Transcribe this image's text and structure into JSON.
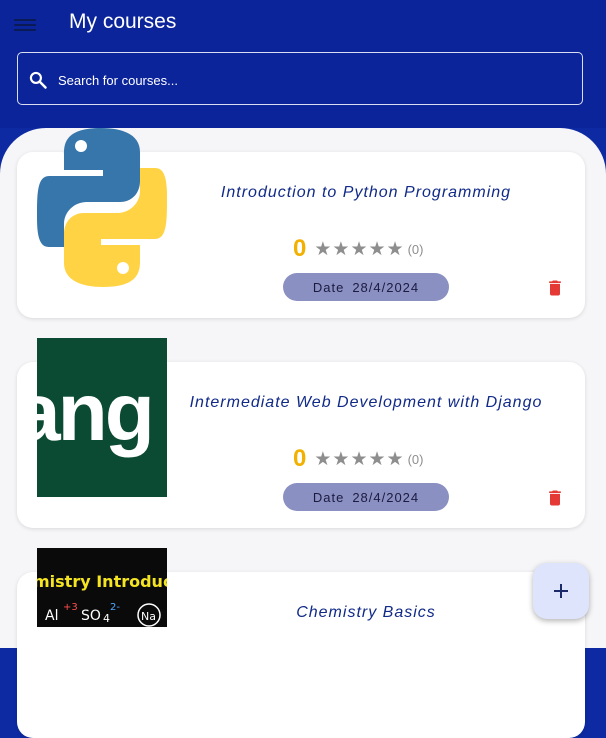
{
  "header": {
    "title": "My courses",
    "menu_icon": "menu-icon"
  },
  "search": {
    "placeholder": "Search for courses...",
    "icon": "search-icon"
  },
  "courses": [
    {
      "title": "Introduction to Python Programming",
      "thumbnail": "python-logo",
      "rating_value": "0",
      "stars": 5,
      "rating_count": "(0)",
      "date_label": "Date",
      "date": "28/4/2024",
      "delete_icon": "trash-icon"
    },
    {
      "title": "Intermediate Web Development with Django",
      "thumbnail": "django-logo",
      "thumbnail_text": "ang",
      "rating_value": "0",
      "stars": 5,
      "rating_count": "(0)",
      "date_label": "Date",
      "date": "28/4/2024",
      "delete_icon": "trash-icon"
    },
    {
      "title": "Chemistry Basics",
      "thumbnail": "chemistry-blackboard",
      "thumbnail_text": "mistry Introduc"
    }
  ],
  "fab": {
    "icon": "plus-icon"
  },
  "colors": {
    "primary": "#0b249a",
    "rating": "#f2b100",
    "delete": "#e53935",
    "date_pill": "#8b90c2"
  }
}
